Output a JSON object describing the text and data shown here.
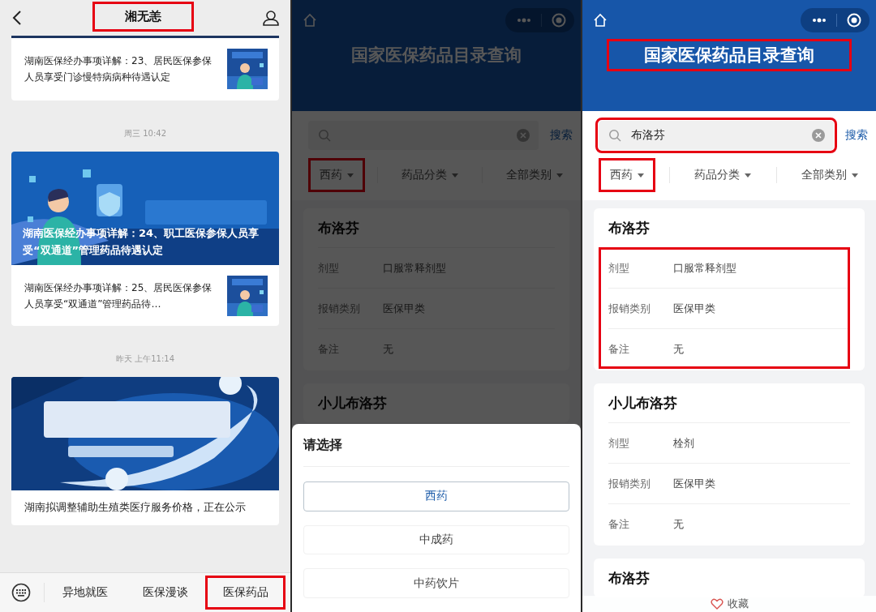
{
  "chat_panel": {
    "header": {
      "title": "湘无恙",
      "title_highlighted": true
    },
    "feed": [
      {
        "kind": "article",
        "title": "湖南医保经办事项详解：23、居民医保参保人员享受门诊慢特病病种待遇认定"
      },
      {
        "kind": "time",
        "text": "周三 10:42"
      },
      {
        "kind": "banner_overlay",
        "title": "湖南医保经办事项详解：24、职工医保参保人员享受“双通道”管理药品待遇认定",
        "sub_articles": [
          {
            "title": "湖南医保经办事项详解：25、居民医保参保人员享受“双通道”管理药品待…"
          }
        ]
      },
      {
        "kind": "time",
        "text": "昨天 上午11:14"
      },
      {
        "kind": "banner_caption",
        "title": "湖南拟调整辅助生殖类医疗服务价格，正在公示"
      }
    ],
    "menu": [
      {
        "label": "异地就医",
        "highlighted": false
      },
      {
        "label": "医保漫谈",
        "highlighted": false
      },
      {
        "label": "医保药品",
        "highlighted": true
      }
    ]
  },
  "query_panels": [
    {
      "title": "国家医保药品目录查询",
      "title_highlighted": false,
      "dimmed": true,
      "search": {
        "highlighted": false
      },
      "search_button": "搜索",
      "filters": [
        {
          "label": "西药",
          "highlighted": true
        },
        {
          "label": "药品分类",
          "highlighted": false
        },
        {
          "label": "全部类别",
          "highlighted": false
        }
      ],
      "cards": [
        {
          "name": "布洛芬",
          "fields_highlighted": false,
          "fields": [
            {
              "label": "剂型",
              "value": "口服常释剂型"
            },
            {
              "label": "报销类别",
              "value": "医保甲类"
            },
            {
              "label": "备注",
              "value": "无"
            }
          ]
        },
        {
          "name": "小儿布洛芬"
        }
      ],
      "sheet": {
        "title": "请选择",
        "options": [
          {
            "label": "西药",
            "selected": true
          },
          {
            "label": "中成药",
            "selected": false
          },
          {
            "label": "中药饮片",
            "selected": false
          }
        ]
      }
    },
    {
      "title": "国家医保药品目录查询",
      "title_highlighted": true,
      "dimmed": false,
      "search": {
        "value": "布洛芬",
        "highlighted": true
      },
      "search_button": "搜索",
      "filters": [
        {
          "label": "西药",
          "highlighted": true
        },
        {
          "label": "药品分类",
          "highlighted": false
        },
        {
          "label": "全部类别",
          "highlighted": false
        }
      ],
      "cards": [
        {
          "name": "布洛芬",
          "fields_highlighted": true,
          "fields": [
            {
              "label": "剂型",
              "value": "口服常释剂型"
            },
            {
              "label": "报销类别",
              "value": "医保甲类"
            },
            {
              "label": "备注",
              "value": "无"
            }
          ]
        },
        {
          "name": "小儿布洛芬",
          "fields_highlighted": false,
          "fields": [
            {
              "label": "剂型",
              "value": "栓剂"
            },
            {
              "label": "报销类别",
              "value": "医保甲类"
            },
            {
              "label": "备注",
              "value": "无"
            }
          ]
        },
        {
          "name": "布洛芬"
        }
      ],
      "footer": {
        "favorite": "收藏"
      }
    }
  ]
}
